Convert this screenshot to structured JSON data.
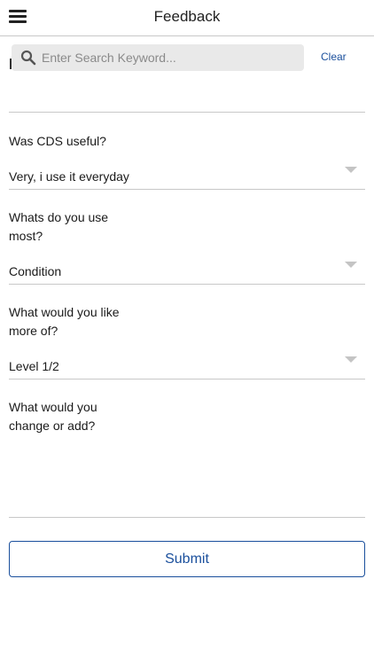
{
  "header": {
    "title": "Feedback",
    "menu_icon": "hamburger-menu-icon"
  },
  "search": {
    "placeholder": "Enter Search Keyword...",
    "value": "",
    "icon": "search-icon",
    "clear_label": "Clear"
  },
  "form": {
    "questions": [
      {
        "label": "Was CDS useful?",
        "selected": "Very, i use it everyday"
      },
      {
        "label": "Whats do you use most?",
        "selected": "Condition"
      },
      {
        "label": "What would you like more of?",
        "selected": "Level 1/2"
      }
    ],
    "comment": {
      "label": "What would you change or add?",
      "value": ""
    },
    "submit_label": "Submit"
  },
  "colors": {
    "accent": "#1a4f9c",
    "divider": "#c8c8c8",
    "search_bg": "#e9e9e9"
  }
}
